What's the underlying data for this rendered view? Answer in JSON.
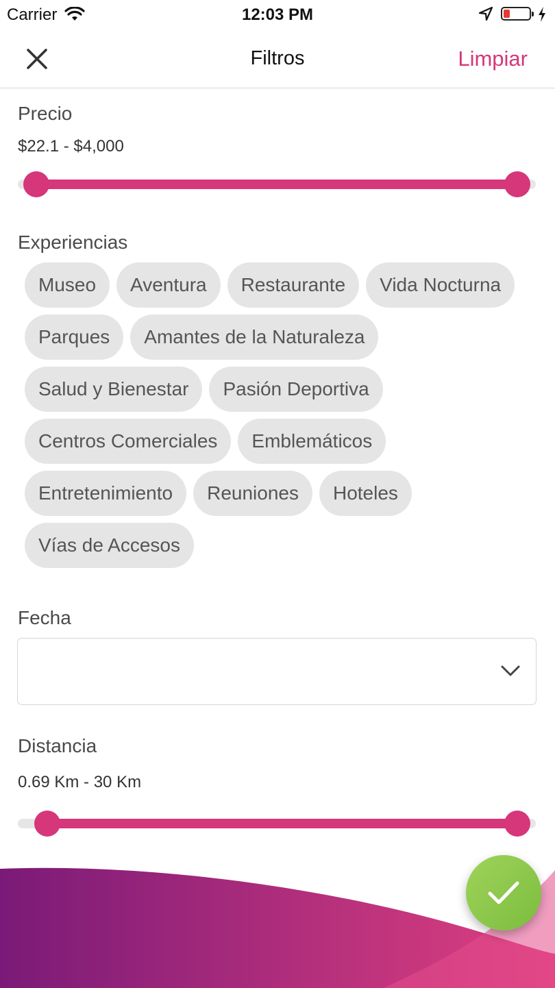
{
  "status_bar": {
    "carrier": "Carrier",
    "time": "12:03 PM",
    "battery_level": 0.25
  },
  "nav": {
    "title": "Filtros",
    "clear_label": "Limpiar",
    "close_icon": "close-icon"
  },
  "price": {
    "label": "Precio",
    "range_text": "$22.1 - $4,000",
    "min_fraction": 0.0,
    "max_fraction": 1.0
  },
  "experiences": {
    "label": "Experiencias",
    "items": [
      "Museo",
      "Aventura",
      "Restaurante",
      "Vida Nocturna",
      "Parques",
      "Amantes de la Naturaleza",
      "Salud y Bienestar",
      "Pasión Deportiva",
      "Centros Comerciales",
      "Emblemáticos",
      "Entretenimiento",
      "Reuniones",
      "Hoteles",
      "Vías de Accesos"
    ]
  },
  "date": {
    "label": "Fecha",
    "value": "",
    "icon": "chevron-down-icon"
  },
  "distance": {
    "label": "Distancia",
    "range_text": "0.69 Km - 30 Km",
    "min_fraction": 0.023,
    "max_fraction": 1.0
  },
  "confirm": {
    "icon": "checkmark-icon"
  },
  "colors": {
    "accent": "#d6367a",
    "confirm": "#8bc34a",
    "wave_start": "#7a1a78",
    "wave_end": "#e0407f"
  }
}
